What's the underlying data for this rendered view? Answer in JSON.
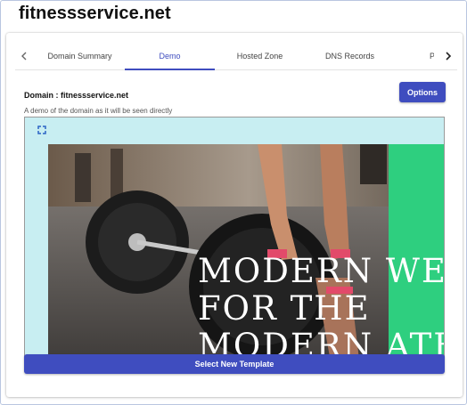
{
  "site_title": "fitnessservice.net",
  "tabs": [
    {
      "label": "Domain Summary"
    },
    {
      "label": "Demo"
    },
    {
      "label": "Hosted Zone"
    },
    {
      "label": "DNS Records"
    },
    {
      "label": "Proxy"
    }
  ],
  "active_tab": "Demo",
  "domain_label": "Domain : fitnessservice.net",
  "options_button": "Options",
  "demo_description": "A demo of the domain as it will be seen directly",
  "preview": {
    "headline_lines": [
      "MODERN WEL",
      "FOR THE",
      "MODERN ATH"
    ]
  },
  "select_button": "Select New Template",
  "colors": {
    "accent": "#3f4dbf",
    "preview_background": "#c8eef2",
    "green_panel": "#2ecf7f"
  },
  "icons": {
    "tab_left": "chevron-left-icon",
    "tab_right": "chevron-right-icon",
    "fullscreen": "fullscreen-expand-icon"
  }
}
